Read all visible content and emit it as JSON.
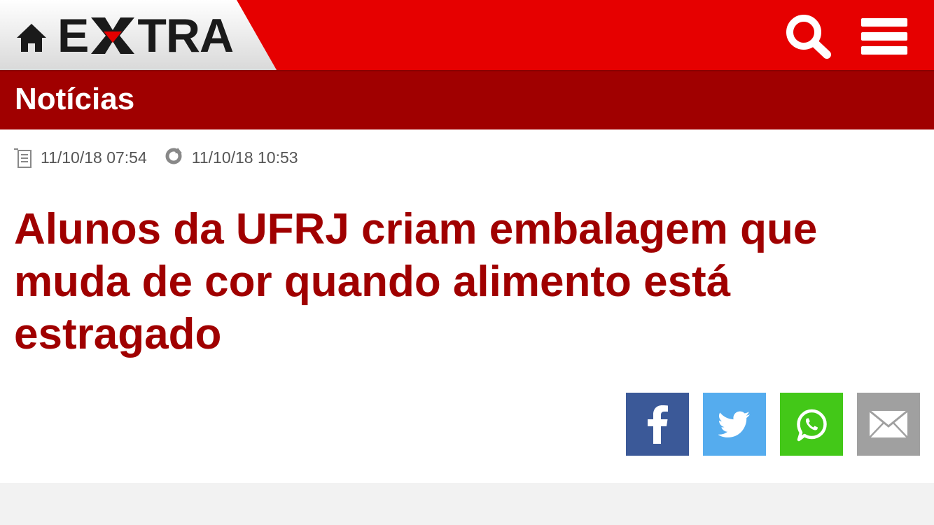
{
  "header": {
    "brand": "EXTRA",
    "brand_left": "E",
    "brand_right": "TRA",
    "icons": [
      "home-icon",
      "search-icon",
      "hamburger-menu-icon"
    ],
    "colors": {
      "header_red": "#e60000",
      "section_red": "#a00000"
    }
  },
  "section": {
    "title": "Notícias"
  },
  "article": {
    "published": "11/10/18 07:54",
    "updated": "11/10/18 10:53",
    "headline": "Alunos da UFRJ criam embalagem que muda de cor quando alimento está estragado",
    "share": [
      {
        "name": "facebook",
        "icon": "facebook-icon",
        "color": "#3b5998"
      },
      {
        "name": "twitter",
        "icon": "twitter-icon",
        "color": "#55acee"
      },
      {
        "name": "whatsapp",
        "icon": "whatsapp-icon",
        "color": "#43c818"
      },
      {
        "name": "email",
        "icon": "envelope-icon",
        "color": "#a0a0a0"
      }
    ]
  }
}
